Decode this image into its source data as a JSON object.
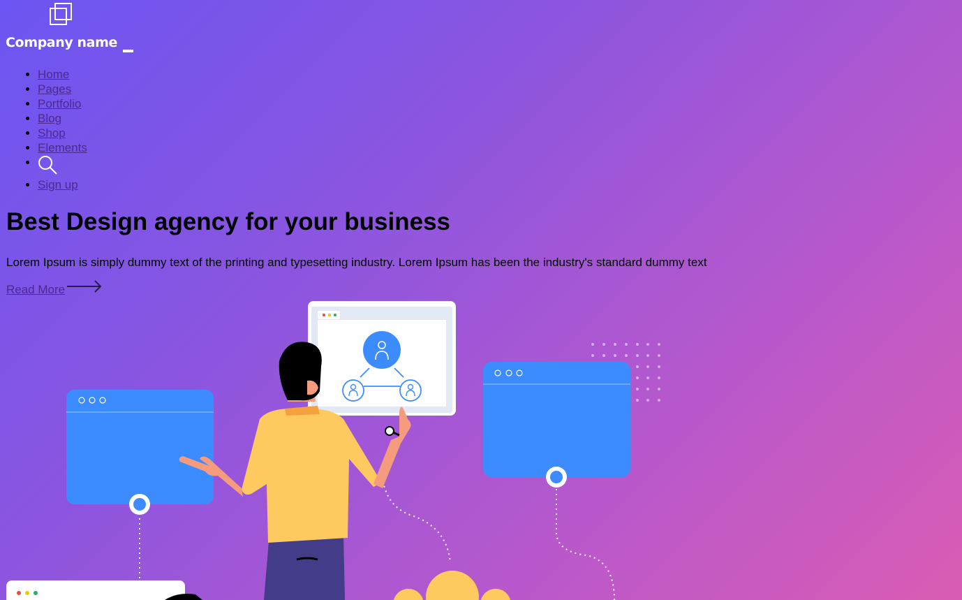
{
  "brand": {
    "logo_icon": "overlapping-squares-logo-icon",
    "name": "Company name"
  },
  "nav": {
    "items": [
      {
        "label": "Home"
      },
      {
        "label": "Pages"
      },
      {
        "label": "Portfolio"
      },
      {
        "label": "Blog"
      },
      {
        "label": "Shop"
      },
      {
        "label": "Elements"
      }
    ],
    "search_icon": "magnifier-search-icon",
    "signup_label": "Sign up"
  },
  "hero": {
    "title": "Best Design agency for your business",
    "text": "Lorem Ipsum is simply dummy text of the printing and typesetting industry. Lorem Ipsum has been the industry's standard dummy text",
    "read_more_label": "Read More ",
    "read_more_icon": "long-arrow-right-icon"
  },
  "colors": {
    "gradient_start": "#6c55f2",
    "gradient_end": "#d95cb3",
    "link": "#4b2a8f",
    "window_blue": "#3c8bff",
    "shirt_yellow": "#fec95e",
    "pants_navy": "#433c88"
  }
}
